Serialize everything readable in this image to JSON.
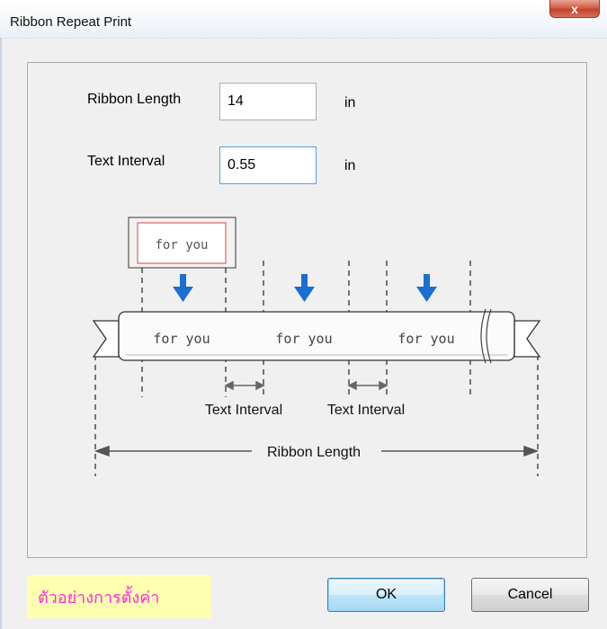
{
  "window": {
    "title": "Ribbon Repeat Print",
    "close_label": "x"
  },
  "form": {
    "ribbon_length": {
      "label": "Ribbon Length",
      "value": "14",
      "unit": "in"
    },
    "text_interval": {
      "label": "Text Interval",
      "value": "0.55",
      "unit": "in"
    }
  },
  "diagram": {
    "sample_text": "for you",
    "text_interval_label_1": "Text Interval",
    "text_interval_label_2": "Text Interval",
    "ribbon_length_label": "Ribbon Length",
    "arrow_color": "#1a6fd1"
  },
  "footer": {
    "sample_settings": "ตัวอย่างการตั้งค่า",
    "ok_label": "OK",
    "cancel_label": "Cancel"
  }
}
